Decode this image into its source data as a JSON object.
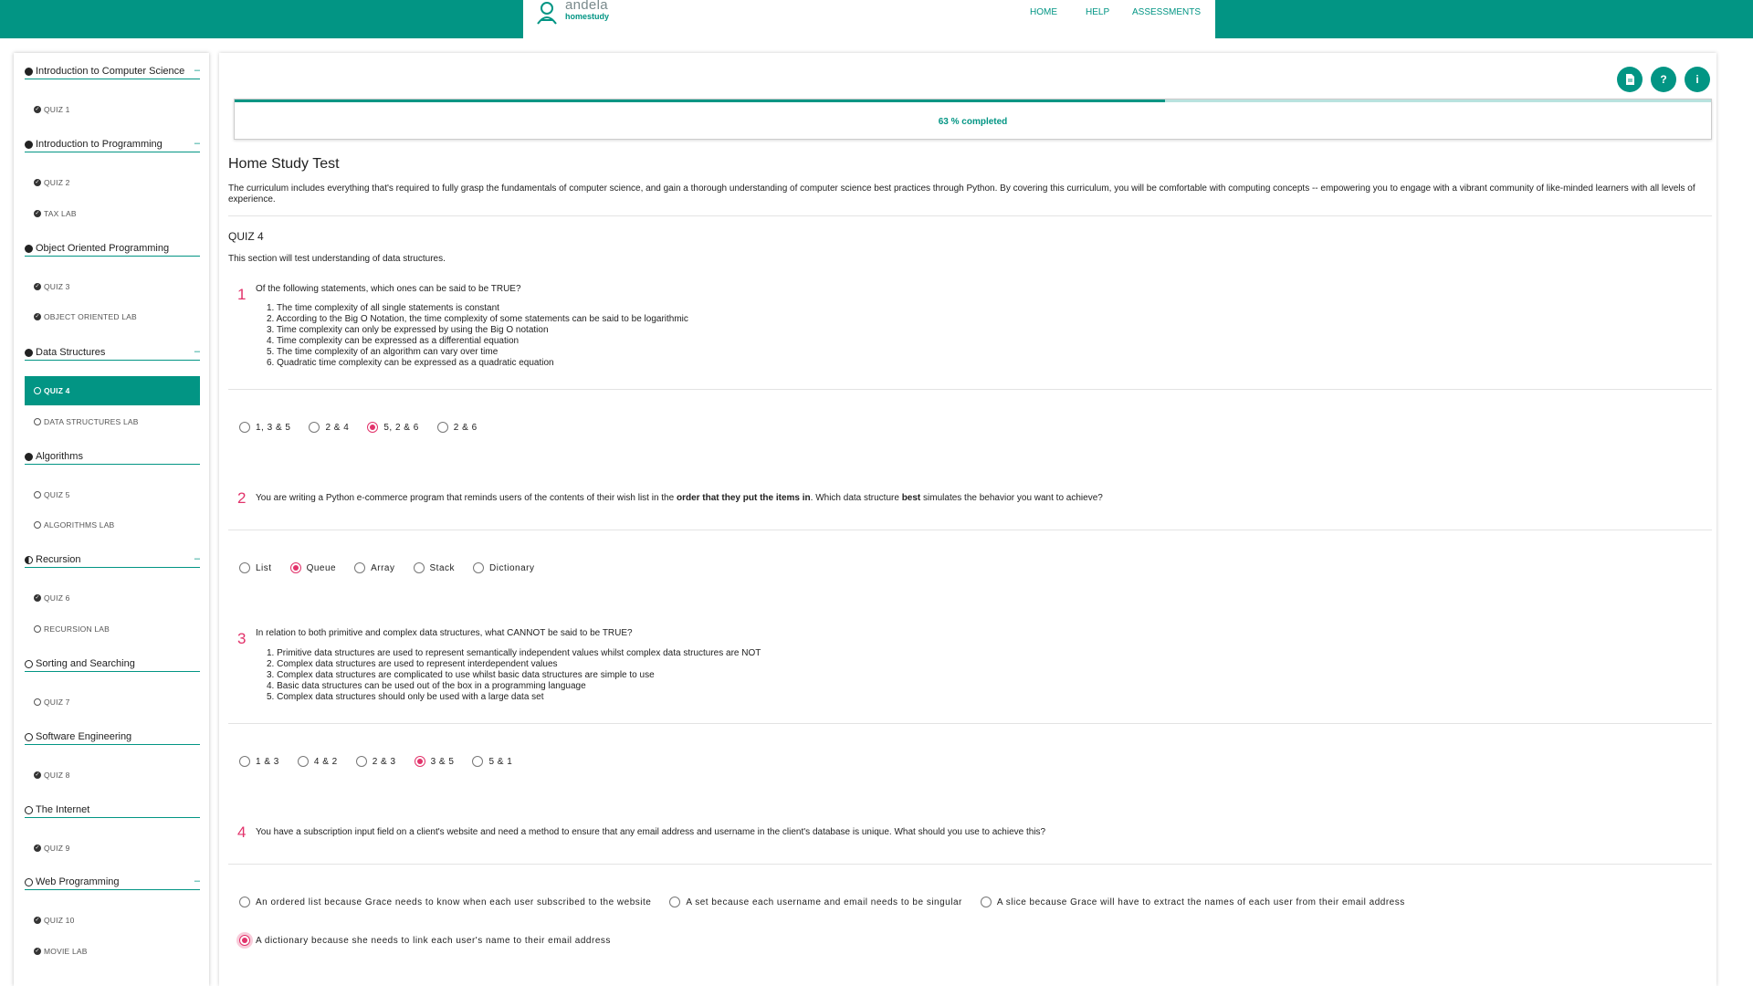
{
  "brand": {
    "name": "andela",
    "sub": "homestudy",
    "color": "#029584"
  },
  "nav": {
    "home": "HOME",
    "help": "HELP",
    "assessments": "ASSESSMENTS"
  },
  "sidebar": {
    "sections": [
      {
        "title": "Introduction to Computer Science",
        "status": "filled",
        "collapse": "–",
        "items": [
          {
            "label": "QUIZ 1",
            "done": true
          }
        ]
      },
      {
        "title": "Introduction to Programming",
        "status": "filled",
        "collapse": "–",
        "items": [
          {
            "label": "QUIZ 2",
            "done": true
          },
          {
            "label": "TAX LAB",
            "done": true
          }
        ]
      },
      {
        "title": "Object Oriented Programming",
        "status": "filled",
        "collapse": "",
        "items": [
          {
            "label": "QUIZ 3",
            "done": true
          },
          {
            "label": "OBJECT ORIENTED LAB",
            "done": true
          }
        ]
      },
      {
        "title": "Data Structures",
        "status": "filled",
        "collapse": "–",
        "items": [
          {
            "label": "QUIZ 4",
            "done": false,
            "active": true
          },
          {
            "label": "DATA STRUCTURES LAB",
            "done": false
          }
        ]
      },
      {
        "title": "Algorithms",
        "status": "filled",
        "collapse": "",
        "items": [
          {
            "label": "QUIZ 5",
            "done": false
          },
          {
            "label": "ALGORITHMS LAB",
            "done": false
          }
        ]
      },
      {
        "title": "Recursion",
        "status": "half",
        "collapse": "–",
        "items": [
          {
            "label": "QUIZ 6",
            "done": true
          },
          {
            "label": "RECURSION LAB",
            "done": false
          }
        ]
      },
      {
        "title": "Sorting and Searching",
        "status": "empty",
        "collapse": "",
        "items": [
          {
            "label": "QUIZ 7",
            "done": false
          }
        ]
      },
      {
        "title": "Software Engineering",
        "status": "empty",
        "collapse": "",
        "items": [
          {
            "label": "QUIZ 8",
            "done": true
          }
        ]
      },
      {
        "title": "The Internet",
        "status": "empty",
        "collapse": "",
        "items": [
          {
            "label": "QUIZ 9",
            "done": true
          }
        ]
      },
      {
        "title": "Web Programming",
        "status": "empty",
        "collapse": "–",
        "items": [
          {
            "label": "QUIZ 10",
            "done": true
          },
          {
            "label": "MOVIE LAB",
            "done": true
          }
        ]
      }
    ]
  },
  "toolbar": {
    "icons": [
      "document-icon",
      "help-icon",
      "info-icon"
    ]
  },
  "progress": {
    "percent": 63,
    "text": "63 % completed"
  },
  "test": {
    "title": "Home Study Test",
    "intro": "The curriculum includes everything that's required to fully grasp the fundamentals of computer science, and gain a thorough understanding of computer science best practices through Python. By covering this curriculum, you will be comfortable with computing concepts -- empowering you to engage with a vibrant community of like-minded learners with all levels of experience."
  },
  "quiz": {
    "title": "QUIZ 4",
    "description": "This section will test understanding of data structures.",
    "questions": [
      {
        "number": "1",
        "text": "Of the following statements, which ones can be said to be TRUE?",
        "statements": [
          "1. The time complexity of all single statements is constant",
          "2. According to the Big O Notation, the time complexity of some statements can be said to be logarithmic",
          "3. Time complexity can only be expressed by using the Big O notation",
          "4. Time complexity can be expressed as a differential equation",
          "5. The time complexity of an algorithm can vary over time",
          "6. Quadratic time complexity can be expressed as a quadratic equation"
        ],
        "options": [
          "1, 3 & 5",
          "2 & 4",
          "5, 2 & 6",
          "2 & 6"
        ],
        "selected": 2
      },
      {
        "number": "2",
        "text_parts": [
          "You are writing a Python e-commerce program that reminds users of the contents of their wish list in the ",
          "order that they put the items in",
          ". Which data structure ",
          "best",
          " simulates the behavior you want to achieve?"
        ],
        "options": [
          "List",
          "Queue",
          "Array",
          "Stack",
          "Dictionary"
        ],
        "selected": 1
      },
      {
        "number": "3",
        "text": "In relation to both primitive and complex data structures, what CANNOT be said to be TRUE?",
        "statements": [
          "1. Primitive data structures are used to represent semantically independent values whilst complex data structures are NOT",
          "2. Complex data structures are used to represent interdependent values",
          "3. Complex data structures are complicated to use whilst basic data structures are simple to use",
          "4. Basic data structures can be used out of the box in a programming language",
          "5. Complex data structures should only be used with a large data set"
        ],
        "options": [
          "1 & 3",
          "4 & 2",
          "2 & 3",
          "3 & 5",
          "5 & 1"
        ],
        "selected": 3
      },
      {
        "number": "4",
        "text": "You have a subscription input field on a client's website and need a method to ensure that any email address and username in the client's database is unique. What should you use to achieve this?",
        "options": [
          "An ordered list because Grace needs to know when each user subscribed to the website",
          "A set because each username and email needs to be singular",
          "A slice because Grace will have to extract the names of each user from their email address",
          "A dictionary because she needs to link each user's name to their email address"
        ],
        "selected": 3
      }
    ]
  }
}
